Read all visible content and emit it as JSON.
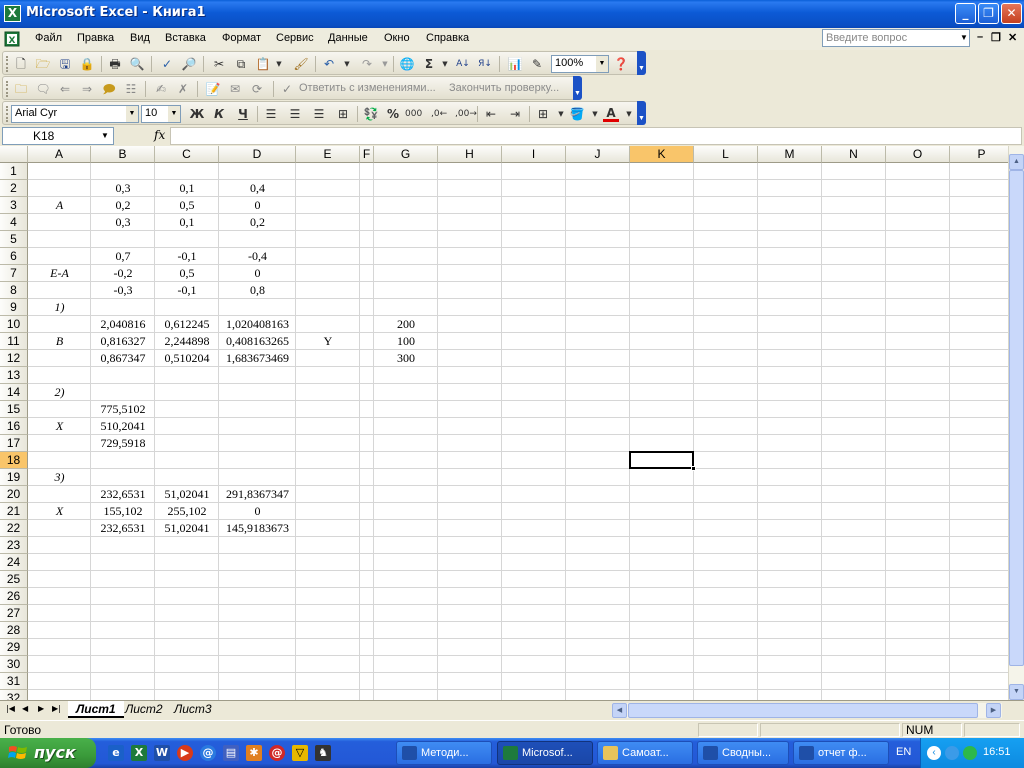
{
  "window": {
    "title": "Microsoft Excel - Книга1",
    "app_icon": "X"
  },
  "menu": {
    "items": [
      {
        "label": "Файл"
      },
      {
        "label": "Правка"
      },
      {
        "label": "Вид"
      },
      {
        "label": "Вставка"
      },
      {
        "label": "Формат"
      },
      {
        "label": "Сервис"
      },
      {
        "label": "Данные"
      },
      {
        "label": "Окно"
      },
      {
        "label": "Справка"
      }
    ],
    "ask_placeholder": "Введите вопрос"
  },
  "toolbar": {
    "zoom": "100%",
    "reply_with_changes": "Ответить с изменениями...",
    "end_review": "Закончить проверку...",
    "font_name": "Arial Cyr",
    "font_size": "10",
    "bold": "Ж",
    "italic": "К",
    "underline": "Ч",
    "percent": "%",
    "thousands": "000"
  },
  "formula_bar": {
    "name_box": "K18",
    "fx_label": "fx",
    "content": ""
  },
  "grid": {
    "columns": [
      "A",
      "B",
      "C",
      "D",
      "E",
      "F",
      "G",
      "H",
      "I",
      "J",
      "K",
      "L",
      "M",
      "N",
      "O",
      "P"
    ],
    "rows": [
      "1",
      "2",
      "3",
      "4",
      "5",
      "6",
      "7",
      "8",
      "9",
      "10",
      "11",
      "12",
      "13",
      "14",
      "15",
      "16",
      "17",
      "18",
      "19",
      "20",
      "21",
      "22",
      "23",
      "24",
      "25",
      "26",
      "27",
      "28",
      "29",
      "30",
      "31",
      "32"
    ],
    "active_cell": "K18",
    "cells": [
      {
        "r": 2,
        "c": "B",
        "v": "0,3"
      },
      {
        "r": 2,
        "c": "C",
        "v": "0,1"
      },
      {
        "r": 2,
        "c": "D",
        "v": "0,4"
      },
      {
        "r": 3,
        "c": "A",
        "v": "A",
        "italic": true
      },
      {
        "r": 3,
        "c": "B",
        "v": "0,2"
      },
      {
        "r": 3,
        "c": "C",
        "v": "0,5"
      },
      {
        "r": 3,
        "c": "D",
        "v": "0"
      },
      {
        "r": 4,
        "c": "B",
        "v": "0,3"
      },
      {
        "r": 4,
        "c": "C",
        "v": "0,1"
      },
      {
        "r": 4,
        "c": "D",
        "v": "0,2"
      },
      {
        "r": 6,
        "c": "B",
        "v": "0,7"
      },
      {
        "r": 6,
        "c": "C",
        "v": "-0,1"
      },
      {
        "r": 6,
        "c": "D",
        "v": "-0,4"
      },
      {
        "r": 7,
        "c": "A",
        "v": "E-A",
        "italic": true
      },
      {
        "r": 7,
        "c": "B",
        "v": "-0,2"
      },
      {
        "r": 7,
        "c": "C",
        "v": "0,5"
      },
      {
        "r": 7,
        "c": "D",
        "v": "0"
      },
      {
        "r": 8,
        "c": "B",
        "v": "-0,3"
      },
      {
        "r": 8,
        "c": "C",
        "v": "-0,1"
      },
      {
        "r": 8,
        "c": "D",
        "v": "0,8"
      },
      {
        "r": 9,
        "c": "A",
        "v": "1)",
        "italic": true
      },
      {
        "r": 10,
        "c": "B",
        "v": "2,040816"
      },
      {
        "r": 10,
        "c": "C",
        "v": "0,612245"
      },
      {
        "r": 10,
        "c": "D",
        "v": "1,020408163"
      },
      {
        "r": 10,
        "c": "G",
        "v": "200"
      },
      {
        "r": 11,
        "c": "A",
        "v": "B",
        "italic": true
      },
      {
        "r": 11,
        "c": "B",
        "v": "0,816327"
      },
      {
        "r": 11,
        "c": "C",
        "v": "2,244898"
      },
      {
        "r": 11,
        "c": "D",
        "v": "0,408163265"
      },
      {
        "r": 11,
        "c": "E",
        "v": "Y"
      },
      {
        "r": 11,
        "c": "G",
        "v": "100"
      },
      {
        "r": 12,
        "c": "B",
        "v": "0,867347"
      },
      {
        "r": 12,
        "c": "C",
        "v": "0,510204"
      },
      {
        "r": 12,
        "c": "D",
        "v": "1,683673469"
      },
      {
        "r": 12,
        "c": "G",
        "v": "300"
      },
      {
        "r": 14,
        "c": "A",
        "v": "2)",
        "italic": true
      },
      {
        "r": 15,
        "c": "B",
        "v": "775,5102"
      },
      {
        "r": 16,
        "c": "A",
        "v": "X",
        "italic": true
      },
      {
        "r": 16,
        "c": "B",
        "v": "510,2041"
      },
      {
        "r": 17,
        "c": "B",
        "v": "729,5918"
      },
      {
        "r": 19,
        "c": "A",
        "v": "3)",
        "italic": true
      },
      {
        "r": 20,
        "c": "B",
        "v": "232,6531"
      },
      {
        "r": 20,
        "c": "C",
        "v": "51,02041"
      },
      {
        "r": 20,
        "c": "D",
        "v": "291,8367347"
      },
      {
        "r": 21,
        "c": "A",
        "v": "X",
        "italic": true
      },
      {
        "r": 21,
        "c": "B",
        "v": "155,102"
      },
      {
        "r": 21,
        "c": "C",
        "v": "255,102"
      },
      {
        "r": 21,
        "c": "D",
        "v": "0"
      },
      {
        "r": 22,
        "c": "B",
        "v": "232,6531"
      },
      {
        "r": 22,
        "c": "C",
        "v": "51,02041"
      },
      {
        "r": 22,
        "c": "D",
        "v": "145,9183673"
      }
    ]
  },
  "sheets": {
    "tabs": [
      "Лист1",
      "Лист2",
      "Лист3"
    ],
    "active": "Лист1"
  },
  "status": {
    "text": "Готово",
    "num": "NUM"
  },
  "taskbar": {
    "start_label": "пуск",
    "buttons": [
      {
        "label": "Методи...",
        "icon": "word-icon"
      },
      {
        "label": "Microsof...",
        "icon": "excel-icon",
        "active": true
      },
      {
        "label": "Самоат...",
        "icon": "folder-icon"
      },
      {
        "label": "Сводны...",
        "icon": "word-icon"
      },
      {
        "label": "отчет ф...",
        "icon": "word-icon"
      }
    ],
    "lang": "EN",
    "clock": "16:51"
  },
  "colors": {
    "accent": "#0a5fd8",
    "active_header": "#f9c56a",
    "taskbar": "#245edb",
    "start": "#3a9a3a"
  }
}
